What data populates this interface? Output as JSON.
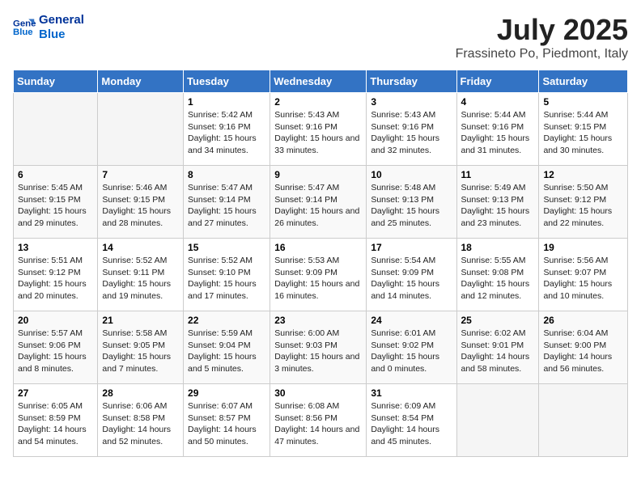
{
  "header": {
    "logo_line1": "General",
    "logo_line2": "Blue",
    "title": "July 2025",
    "subtitle": "Frassineto Po, Piedmont, Italy"
  },
  "days_of_week": [
    "Sunday",
    "Monday",
    "Tuesday",
    "Wednesday",
    "Thursday",
    "Friday",
    "Saturday"
  ],
  "weeks": [
    {
      "days": [
        {
          "num": "",
          "empty": true
        },
        {
          "num": "",
          "empty": true
        },
        {
          "num": "1",
          "rise": "5:42 AM",
          "set": "9:16 PM",
          "daylight": "15 hours and 34 minutes."
        },
        {
          "num": "2",
          "rise": "5:43 AM",
          "set": "9:16 PM",
          "daylight": "15 hours and 33 minutes."
        },
        {
          "num": "3",
          "rise": "5:43 AM",
          "set": "9:16 PM",
          "daylight": "15 hours and 32 minutes."
        },
        {
          "num": "4",
          "rise": "5:44 AM",
          "set": "9:16 PM",
          "daylight": "15 hours and 31 minutes."
        },
        {
          "num": "5",
          "rise": "5:44 AM",
          "set": "9:15 PM",
          "daylight": "15 hours and 30 minutes."
        }
      ]
    },
    {
      "days": [
        {
          "num": "6",
          "rise": "5:45 AM",
          "set": "9:15 PM",
          "daylight": "15 hours and 29 minutes."
        },
        {
          "num": "7",
          "rise": "5:46 AM",
          "set": "9:15 PM",
          "daylight": "15 hours and 28 minutes."
        },
        {
          "num": "8",
          "rise": "5:47 AM",
          "set": "9:14 PM",
          "daylight": "15 hours and 27 minutes."
        },
        {
          "num": "9",
          "rise": "5:47 AM",
          "set": "9:14 PM",
          "daylight": "15 hours and 26 minutes."
        },
        {
          "num": "10",
          "rise": "5:48 AM",
          "set": "9:13 PM",
          "daylight": "15 hours and 25 minutes."
        },
        {
          "num": "11",
          "rise": "5:49 AM",
          "set": "9:13 PM",
          "daylight": "15 hours and 23 minutes."
        },
        {
          "num": "12",
          "rise": "5:50 AM",
          "set": "9:12 PM",
          "daylight": "15 hours and 22 minutes."
        }
      ]
    },
    {
      "days": [
        {
          "num": "13",
          "rise": "5:51 AM",
          "set": "9:12 PM",
          "daylight": "15 hours and 20 minutes."
        },
        {
          "num": "14",
          "rise": "5:52 AM",
          "set": "9:11 PM",
          "daylight": "15 hours and 19 minutes."
        },
        {
          "num": "15",
          "rise": "5:52 AM",
          "set": "9:10 PM",
          "daylight": "15 hours and 17 minutes."
        },
        {
          "num": "16",
          "rise": "5:53 AM",
          "set": "9:09 PM",
          "daylight": "15 hours and 16 minutes."
        },
        {
          "num": "17",
          "rise": "5:54 AM",
          "set": "9:09 PM",
          "daylight": "15 hours and 14 minutes."
        },
        {
          "num": "18",
          "rise": "5:55 AM",
          "set": "9:08 PM",
          "daylight": "15 hours and 12 minutes."
        },
        {
          "num": "19",
          "rise": "5:56 AM",
          "set": "9:07 PM",
          "daylight": "15 hours and 10 minutes."
        }
      ]
    },
    {
      "days": [
        {
          "num": "20",
          "rise": "5:57 AM",
          "set": "9:06 PM",
          "daylight": "15 hours and 8 minutes."
        },
        {
          "num": "21",
          "rise": "5:58 AM",
          "set": "9:05 PM",
          "daylight": "15 hours and 7 minutes."
        },
        {
          "num": "22",
          "rise": "5:59 AM",
          "set": "9:04 PM",
          "daylight": "15 hours and 5 minutes."
        },
        {
          "num": "23",
          "rise": "6:00 AM",
          "set": "9:03 PM",
          "daylight": "15 hours and 3 minutes."
        },
        {
          "num": "24",
          "rise": "6:01 AM",
          "set": "9:02 PM",
          "daylight": "15 hours and 0 minutes."
        },
        {
          "num": "25",
          "rise": "6:02 AM",
          "set": "9:01 PM",
          "daylight": "14 hours and 58 minutes."
        },
        {
          "num": "26",
          "rise": "6:04 AM",
          "set": "9:00 PM",
          "daylight": "14 hours and 56 minutes."
        }
      ]
    },
    {
      "days": [
        {
          "num": "27",
          "rise": "6:05 AM",
          "set": "8:59 PM",
          "daylight": "14 hours and 54 minutes."
        },
        {
          "num": "28",
          "rise": "6:06 AM",
          "set": "8:58 PM",
          "daylight": "14 hours and 52 minutes."
        },
        {
          "num": "29",
          "rise": "6:07 AM",
          "set": "8:57 PM",
          "daylight": "14 hours and 50 minutes."
        },
        {
          "num": "30",
          "rise": "6:08 AM",
          "set": "8:56 PM",
          "daylight": "14 hours and 47 minutes."
        },
        {
          "num": "31",
          "rise": "6:09 AM",
          "set": "8:54 PM",
          "daylight": "14 hours and 45 minutes."
        },
        {
          "num": "",
          "empty": true
        },
        {
          "num": "",
          "empty": true
        }
      ]
    }
  ],
  "labels": {
    "sunrise": "Sunrise:",
    "sunset": "Sunset:",
    "daylight": "Daylight:"
  }
}
